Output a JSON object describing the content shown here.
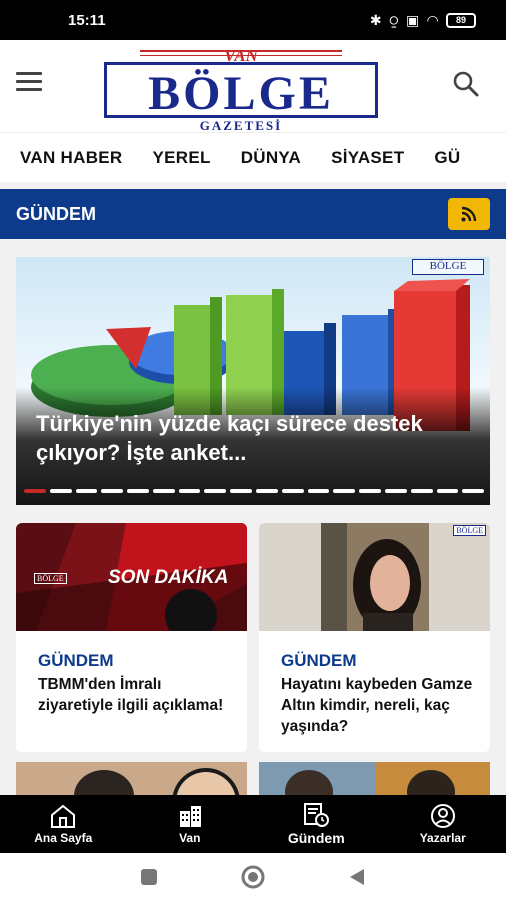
{
  "status_bar": {
    "time": "15:11",
    "battery": "89"
  },
  "header": {
    "logo_top": "VAN",
    "logo_main": "BÖLGE",
    "logo_sub": "GAZETESİ"
  },
  "tabs": [
    "VAN HABER",
    "YEREL",
    "DÜNYA",
    "SİYASET",
    "GÜ"
  ],
  "section": {
    "title": "GÜNDEM"
  },
  "hero": {
    "title": "Türkiye'nin yüzde kaçı sürece destek çıkıyor? İşte anket...",
    "slide_count": 18,
    "active_slide": 0,
    "watermark": "BÖLGE"
  },
  "cards": [
    {
      "category": "GÜNDEM",
      "title": "TBMM'den İmralı ziyaretiyle ilgili açıklama!",
      "image_text": "SON DAKİKA",
      "image_badge": "BÖLGE"
    },
    {
      "category": "GÜNDEM",
      "title": "Hayatını kaybeden Gamze Altın kimdir, nereli, kaç yaşında?",
      "image_badge": "BÖLGE"
    }
  ],
  "bottom_nav": [
    {
      "label": "Ana Sayfa",
      "icon": "home-icon"
    },
    {
      "label": "Van",
      "icon": "city-icon"
    },
    {
      "label": "Gündem",
      "icon": "newspaper-clock-icon"
    },
    {
      "label": "Yazarlar",
      "icon": "user-circle-icon"
    }
  ],
  "colors": {
    "primary": "#0e3a8c",
    "accent": "#f2b705",
    "logo_red": "#c62828"
  }
}
